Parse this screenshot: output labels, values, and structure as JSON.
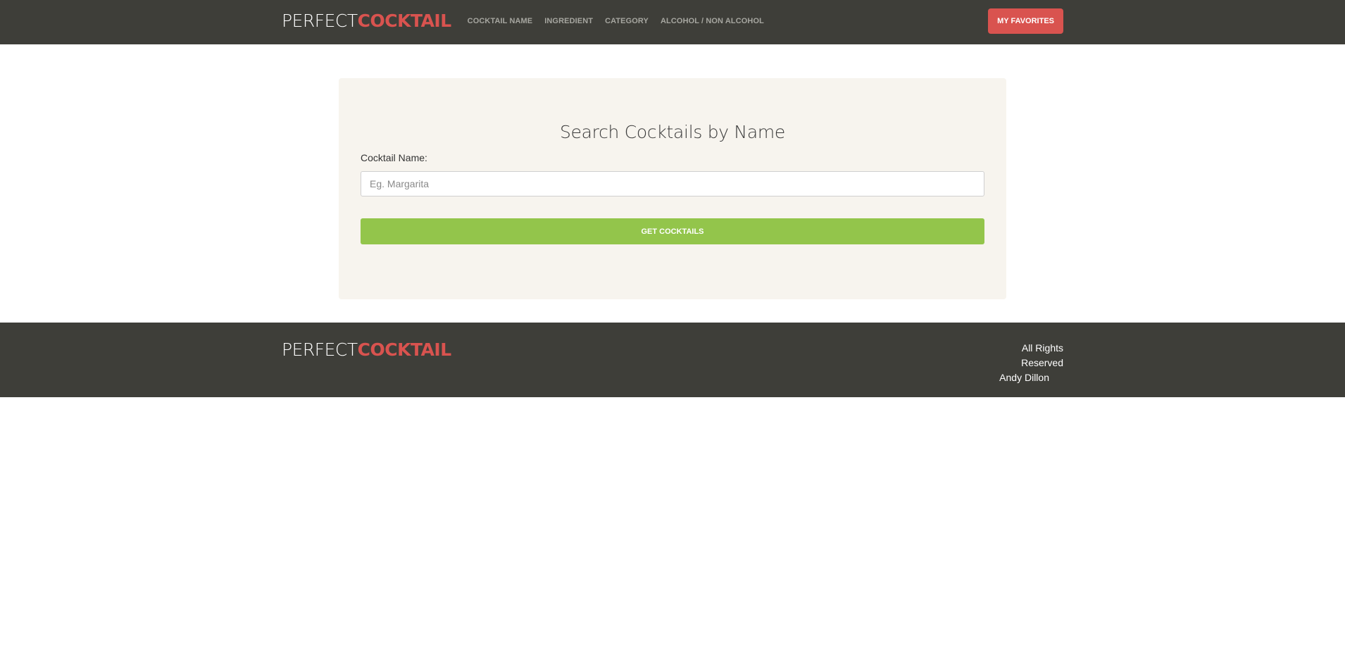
{
  "brand": {
    "part1": "PERFECT",
    "part2": "COCKTAIL"
  },
  "nav": {
    "links": [
      "COCKTAIL NAME",
      "INGREDIENT",
      "CATEGORY",
      "ALCOHOL / NON ALCOHOL"
    ],
    "favorites_label": "MY FAVORITES"
  },
  "search": {
    "title": "Search Cocktails by Name",
    "field_label": "Cocktail Name:",
    "placeholder": "Eg. Margarita",
    "value": "",
    "submit_label": "GET COCKTAILS"
  },
  "footer": {
    "brand_part1": "PERFECT",
    "brand_part2": "COCKTAIL",
    "rights": "All Rights Reserved",
    "author": "Andy Dillon"
  },
  "colors": {
    "header_bg": "#3e3e39",
    "brand_accent": "#d9534f",
    "button_primary": "#93c54b",
    "card_bg": "#f7f4ee"
  }
}
